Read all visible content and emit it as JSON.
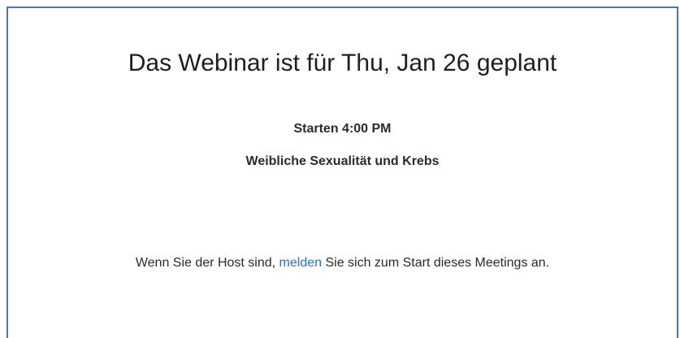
{
  "webinar": {
    "title": "Das Webinar ist für Thu, Jan 26 geplant",
    "start_time": "Starten 4:00 PM",
    "topic": "Weibliche Sexualität und Krebs"
  },
  "host_note": {
    "prefix": "Wenn Sie der Host sind, ",
    "link_label": "melden",
    "suffix": " Sie sich zum Start dieses Meetings an."
  },
  "colors": {
    "frame_border": "#4a78b5",
    "link": "#2d6fd1",
    "text": "#2b2b2b"
  }
}
